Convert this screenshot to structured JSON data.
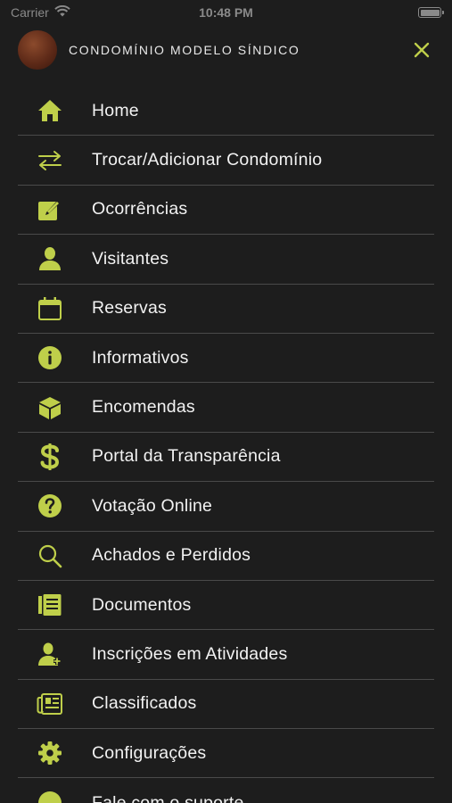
{
  "colors": {
    "accent": "#bfcf4a",
    "background": "#1d1d1d",
    "divider": "#4a4a4a",
    "text": "#f2f2f2"
  },
  "status_bar": {
    "carrier": "Carrier",
    "time": "10:48 PM"
  },
  "header": {
    "condo_name": "CONDOMÍNIO MODELO SÍNDICO",
    "close_icon": "close-icon"
  },
  "menu": {
    "items": [
      {
        "label": "Home",
        "icon": "home-icon"
      },
      {
        "label": "Trocar/Adicionar Condomínio",
        "icon": "swap-arrows-icon"
      },
      {
        "label": "Ocorrências",
        "icon": "edit-note-icon"
      },
      {
        "label": "Visitantes",
        "icon": "person-icon"
      },
      {
        "label": "Reservas",
        "icon": "calendar-icon"
      },
      {
        "label": "Informativos",
        "icon": "info-icon"
      },
      {
        "label": "Encomendas",
        "icon": "package-icon"
      },
      {
        "label": "Portal da Transparência",
        "icon": "dollar-icon"
      },
      {
        "label": "Votação Online",
        "icon": "question-icon"
      },
      {
        "label": "Achados e Perdidos",
        "icon": "search-icon"
      },
      {
        "label": "Documentos",
        "icon": "document-icon"
      },
      {
        "label": "Inscrições em Atividades",
        "icon": "person-add-icon"
      },
      {
        "label": "Classificados",
        "icon": "newspaper-icon"
      },
      {
        "label": "Configurações",
        "icon": "gear-icon"
      },
      {
        "label": "Fale com o suporte",
        "icon": "chat-icon"
      }
    ]
  }
}
